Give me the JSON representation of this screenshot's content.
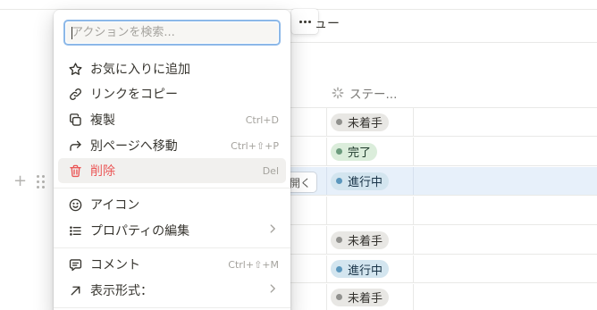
{
  "header": {
    "view_label_partial": "ュー"
  },
  "table": {
    "status_column": {
      "label": "ステー..."
    },
    "rows": [
      {
        "status": "未着手",
        "color": "gray"
      },
      {
        "status": "完了",
        "color": "green"
      },
      {
        "status": "進行中",
        "color": "blue",
        "open_label": "開く",
        "highlighted": true
      },
      {
        "status": ""
      },
      {
        "status": "未着手",
        "color": "gray"
      },
      {
        "status": "進行中",
        "color": "blue"
      },
      {
        "status": "未着手",
        "color": "gray"
      }
    ]
  },
  "row_controls": {
    "add_glyph": "+"
  },
  "menu": {
    "search_placeholder": "アクションを検索...",
    "items": [
      {
        "icon": "star-icon",
        "label": "お気に入りに追加"
      },
      {
        "icon": "link-icon",
        "label": "リンクをコピー"
      },
      {
        "icon": "duplicate-icon",
        "label": "複製",
        "shortcut": "Ctrl+D"
      },
      {
        "icon": "move-to-icon",
        "label": "別ページへ移動",
        "shortcut": "Ctrl+⇧+P"
      },
      {
        "icon": "trash-icon",
        "label": "削除",
        "shortcut": "Del",
        "danger": true
      },
      {
        "icon": "smiley-icon",
        "label": "アイコン"
      },
      {
        "icon": "list-icon",
        "label": "プロパティの編集",
        "submenu": true
      },
      {
        "icon": "comment-icon",
        "label": "コメント",
        "shortcut": "Ctrl+⇧+M"
      },
      {
        "icon": "arrow-up-right-icon",
        "label": "表示形式：",
        "submenu": true
      }
    ]
  },
  "colors": {
    "danger": "#eb5757",
    "focus_ring": "#8cb8e8",
    "row_highlight": "#e7f0fa",
    "tag_gray_bg": "#e8e7e4",
    "tag_green_bg": "#dbeddb",
    "tag_blue_bg": "#d3e5ef"
  }
}
